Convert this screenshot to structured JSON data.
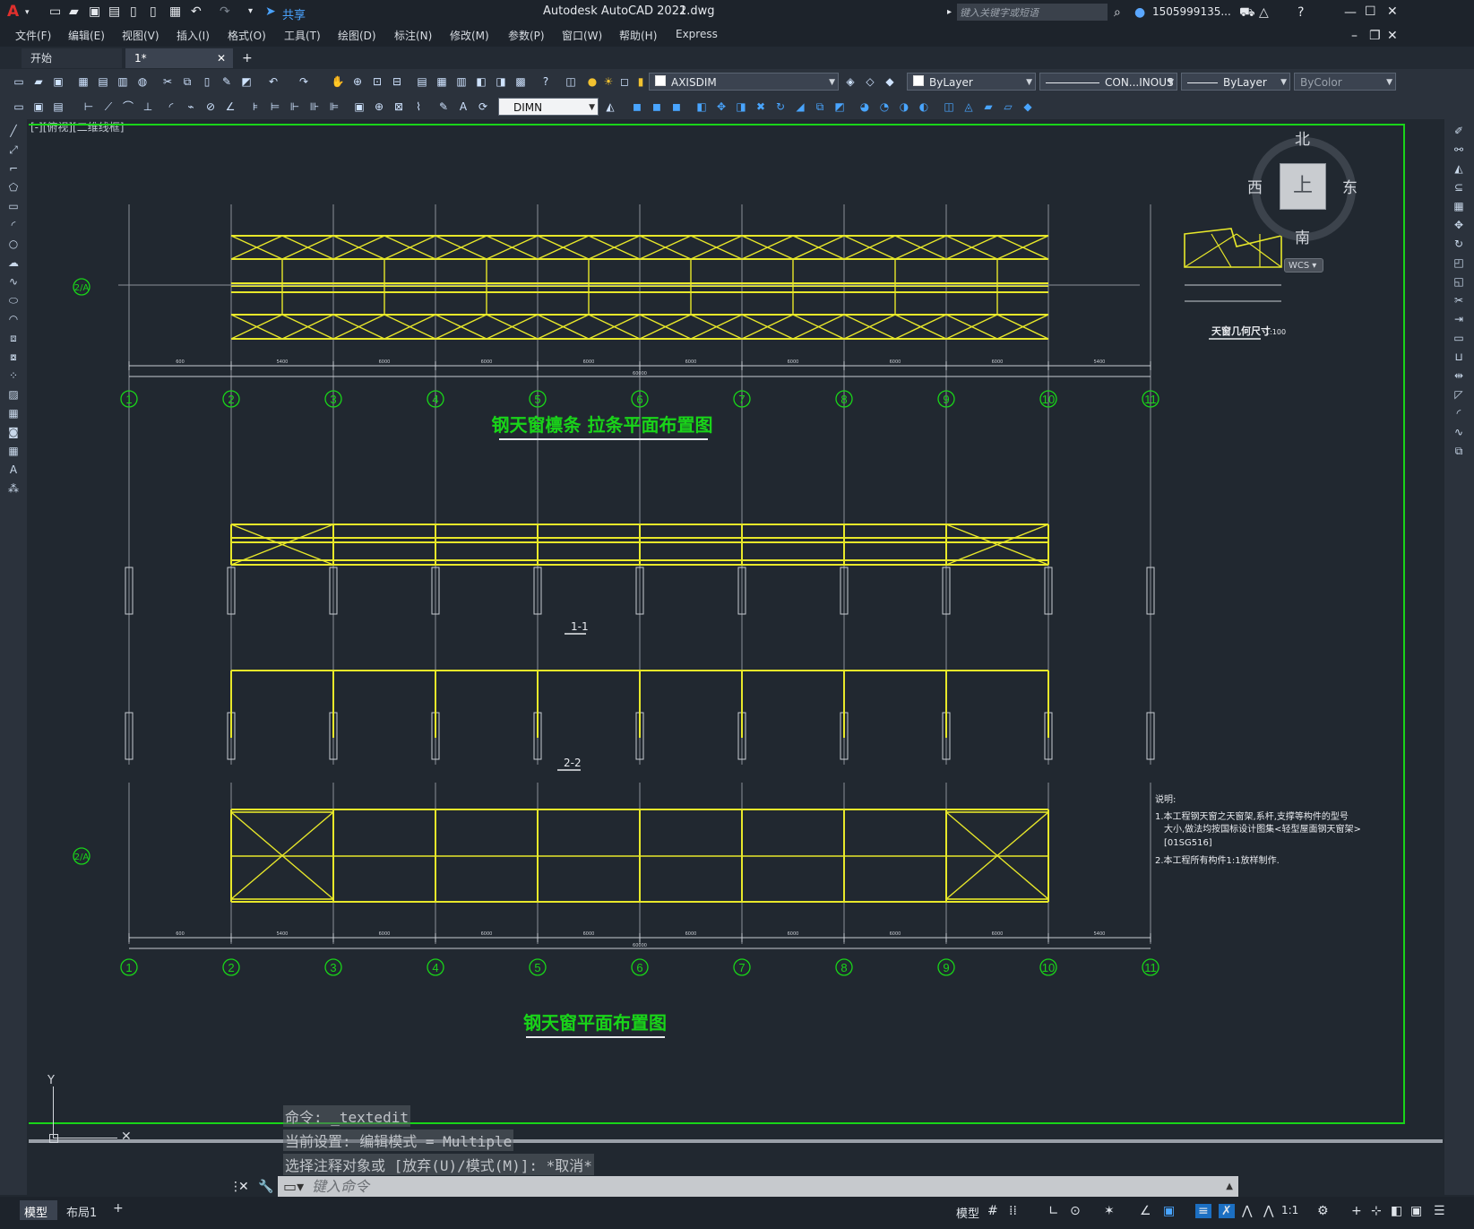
{
  "app": {
    "title": "Autodesk AutoCAD 2022",
    "filename": "1.dwg",
    "share_label": "共享",
    "search_placeholder": "键入关键字或短语",
    "user": "1505999135...",
    "help_icon": "?"
  },
  "menu": [
    "文件(F)",
    "编辑(E)",
    "视图(V)",
    "插入(I)",
    "格式(O)",
    "工具(T)",
    "绘图(D)",
    "标注(N)",
    "修改(M)",
    "参数(P)",
    "窗口(W)",
    "帮助(H)",
    "Express"
  ],
  "tabs": {
    "start": "开始",
    "doc": "1*",
    "add": "+"
  },
  "toolbar": {
    "layer": "AXISDIM",
    "color": "ByLayer",
    "linetype": "CON...INOUS",
    "lineweight": "ByLayer",
    "plotstyle": "ByColor",
    "dimstyle": "DIMN"
  },
  "viewport_label": "[-][俯视][二维线框]",
  "viewcube": {
    "north": "北",
    "south": "南",
    "east": "东",
    "west": "西",
    "top": "上",
    "wcs": "WCS"
  },
  "drawing": {
    "grid_labels": [
      "1",
      "2",
      "3",
      "4",
      "5",
      "6",
      "7",
      "8",
      "9",
      "10",
      "11"
    ],
    "axis_tag": "2/A",
    "title_top": "钢天窗檩条 拉条平面布置图",
    "title_bottom": "钢天窗平面布置图",
    "section_1": "1-1",
    "section_2": "2-2",
    "detail_title": "天窗几何尺寸",
    "detail_scale": "1:100",
    "dims_row": [
      "600",
      "5400",
      "6000",
      "6000",
      "6000",
      "6000",
      "6000",
      "6000",
      "6000",
      "5400",
      "600"
    ],
    "dim_total": "60000",
    "notes_title": "说明:",
    "notes": [
      "1.本工程钢天窗之天窗架,系杆,支撑等构件的型号",
      "大小,做法均按国标设计图集<轻型屋面钢天窗架>",
      "[01SG516]",
      "2.本工程所有构件1:1放样制作."
    ]
  },
  "command": {
    "line1": "命令: _textedit",
    "line2": "当前设置: 编辑模式 = Multiple",
    "line3": "选择注释对象或 [放弃(U)/模式(M)]: *取消*",
    "placeholder": "键入命令"
  },
  "layout_tabs": {
    "model": "模型",
    "layout1": "布局1",
    "add": "+"
  },
  "status": {
    "model": "模型",
    "scale": "1:1"
  },
  "colors": {
    "structure": "#e8e82a",
    "grid_green": "#19d419",
    "bg": "#212830"
  }
}
